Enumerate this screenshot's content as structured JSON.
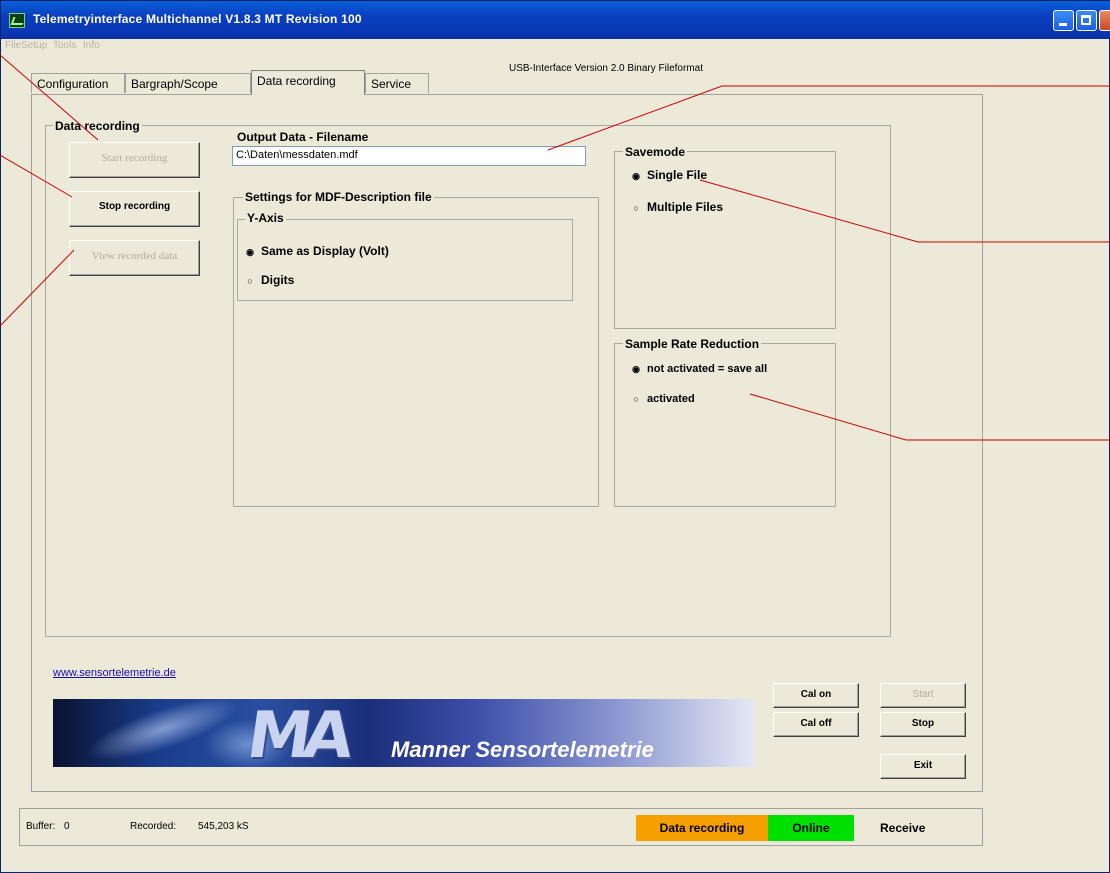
{
  "window": {
    "title": "Telemetryinterface Multichannel V1.8.3 MT Revision 100"
  },
  "menu": [
    "File",
    "Setup",
    "Tools",
    "Info"
  ],
  "usb_info": "USB-Interface Version 2.0  Binary Fileformat",
  "tabs": [
    "Configuration",
    "Bargraph/Scope",
    "Data recording",
    "Service"
  ],
  "active_tab": "Data recording",
  "data_recording": {
    "group_title": "Data recording",
    "start_label": "Start recording",
    "stop_label": "Stop recording",
    "view_label": "View recorded data"
  },
  "output": {
    "label": "Output Data - Filename",
    "filename": "C:\\Daten\\messdaten.mdf"
  },
  "mdf_settings": {
    "title": "Settings for MDF-Description file",
    "yaxis_title": "Y-Axis",
    "options": [
      "Same as Display (Volt)",
      "Digits"
    ],
    "selected": "Same as Display (Volt)"
  },
  "savemode": {
    "title": "Savemode",
    "options": [
      "Single File",
      "Multiple Files"
    ],
    "selected": "Single File"
  },
  "sample_rate": {
    "title": "Sample Rate Reduction",
    "options": [
      "not activated = save all",
      "activated"
    ],
    "selected": "not activated = save all"
  },
  "website": "www.sensortelemetrie.de",
  "banner": {
    "logo": "MA",
    "text": "Manner Sensortelemetrie"
  },
  "buttons": {
    "cal_on": "Cal on",
    "cal_off": "Cal off",
    "start": "Start",
    "stop": "Stop",
    "exit": "Exit"
  },
  "status": {
    "buffer_label": "Buffer:",
    "buffer_value": "0",
    "recorded_label": "Recorded:",
    "recorded_value": "545,203 kS",
    "mode": "Data recording",
    "connection": "Online",
    "direction": "Receive"
  },
  "colors": {
    "titlebar": "#0b38b4",
    "window_bg": "#ece9d8",
    "status_recording": "#f5a000",
    "status_online": "#00e000",
    "annotation_line": "#cc0000"
  }
}
